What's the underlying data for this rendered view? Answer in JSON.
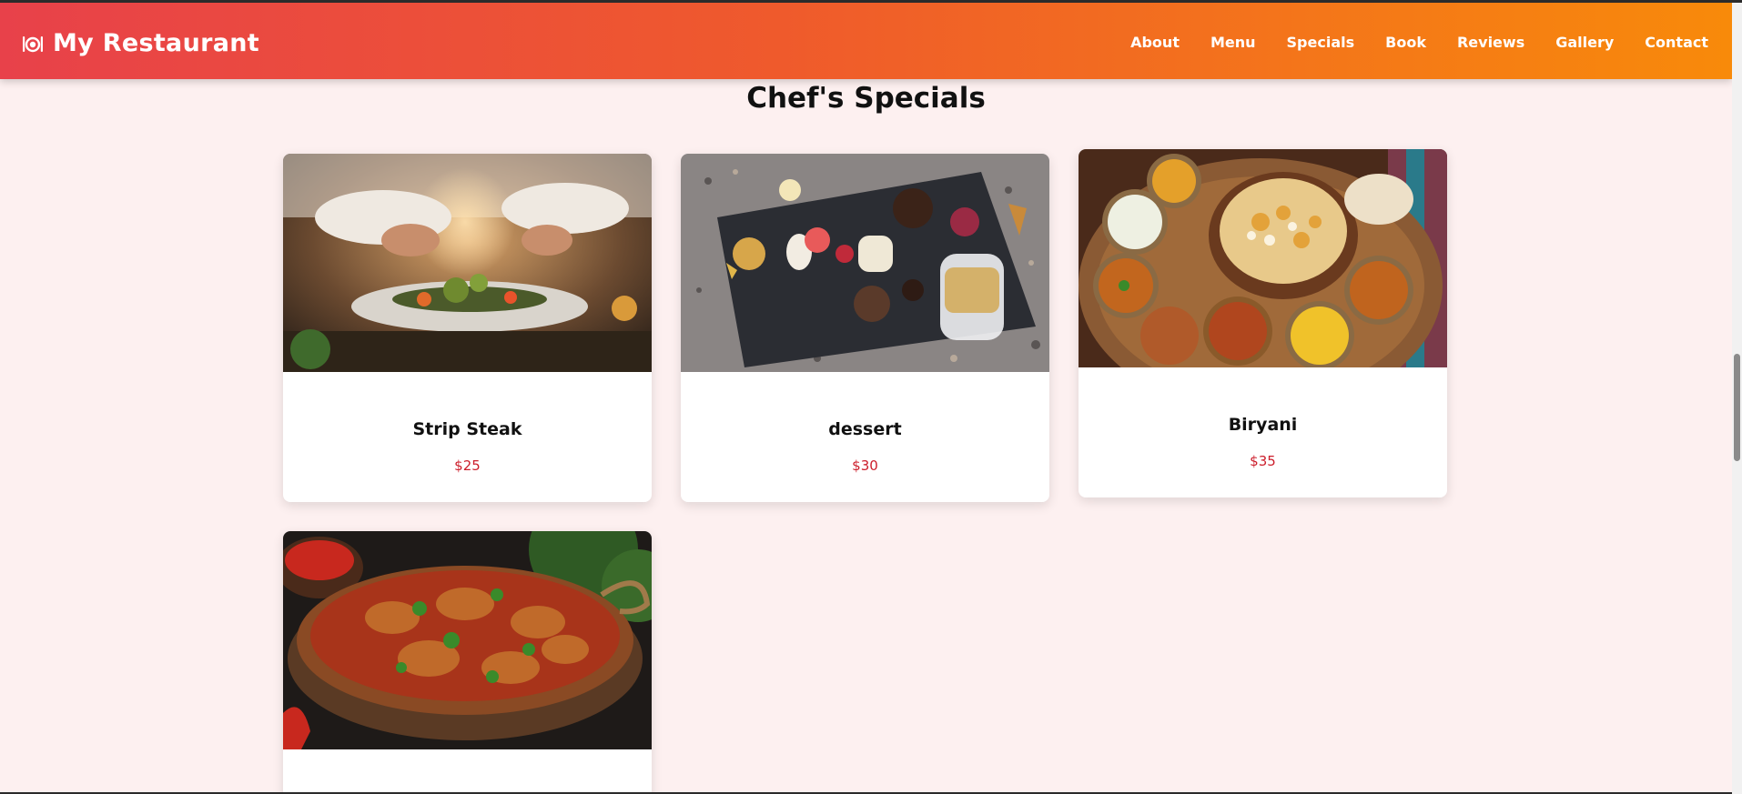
{
  "header": {
    "brand": "My Restaurant",
    "brand_icon": "plate-cutlery-icon",
    "nav": [
      "About",
      "Menu",
      "Specials",
      "Book",
      "Reviews",
      "Gallery",
      "Contact"
    ]
  },
  "specials": {
    "title": "Chef's Specials",
    "items": [
      {
        "name": "Strip Steak",
        "price": "$25",
        "photo": "chef-plating-dish-photo"
      },
      {
        "name": "dessert",
        "price": "$30",
        "photo": "dessert-platter-photo"
      },
      {
        "name": "Biryani",
        "price": "$35",
        "photo": "biryani-thali-photo"
      },
      {
        "name": "",
        "price": "",
        "photo": "curry-pan-photo"
      }
    ]
  },
  "colors": {
    "header_gradient_start": "#e8414a",
    "header_gradient_end": "#f88a0a",
    "page_background": "#fdf0f0",
    "price_color": "#cc1e2b"
  }
}
